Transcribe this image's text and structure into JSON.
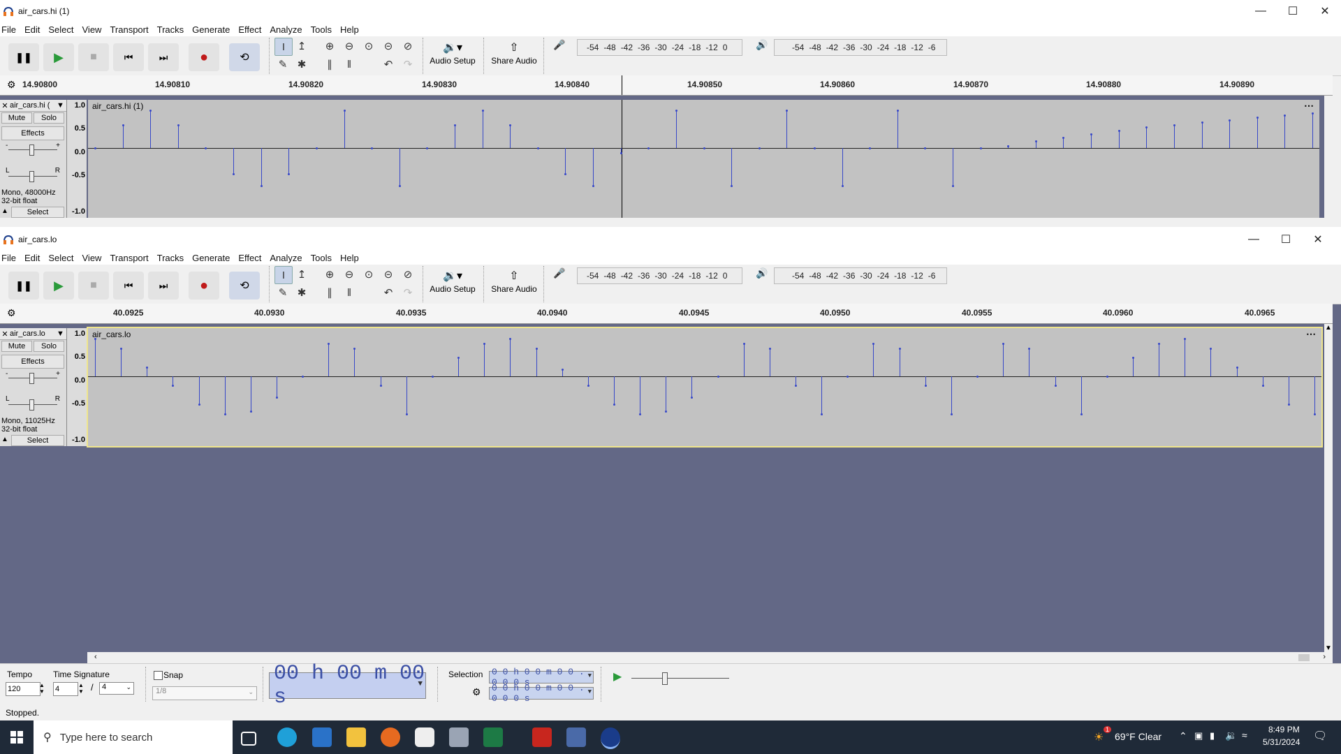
{
  "colors": {
    "accent": "#3647c8",
    "track_bg": "#636886",
    "wave_bg": "#c2c2c2",
    "time_text": "#3b4fa5"
  },
  "window1": {
    "title": "air_cars.hi (1)",
    "menu": [
      "File",
      "Edit",
      "Select",
      "View",
      "Transport",
      "Tracks",
      "Generate",
      "Effect",
      "Analyze",
      "Tools",
      "Help"
    ],
    "audio_setup": "Audio Setup",
    "share_audio": "Share Audio",
    "rec_meter": [
      "-54",
      "-48",
      "-42",
      "-36",
      "-30",
      "-24",
      "-18",
      "-12",
      "0"
    ],
    "play_meter": [
      "-54",
      "-48",
      "-42",
      "-36",
      "-30",
      "-24",
      "-18",
      "-12",
      "-6"
    ],
    "ruler": [
      "14.90800",
      "14.90810",
      "14.90820",
      "14.90830",
      "14.90840",
      "14.90850",
      "14.90860",
      "14.90870",
      "14.90880",
      "14.90890"
    ],
    "track": {
      "name": "air_cars.hi (",
      "clip": "air_cars.hi (1)",
      "mute": "Mute",
      "solo": "Solo",
      "effects": "Effects",
      "info1": "Mono, 48000Hz",
      "info2": "32-bit float",
      "select": "Select",
      "pan_l": "L",
      "pan_r": "R",
      "gain_minus": "-",
      "gain_plus": "+"
    },
    "scale": [
      "1.0",
      "0.5",
      "0.0",
      "-0.5",
      "-1.0"
    ],
    "samples": [
      0,
      0.5,
      0.8,
      0.5,
      0,
      -0.55,
      -0.8,
      -0.55,
      0,
      0.8,
      0,
      -0.8,
      0,
      0.5,
      0.8,
      0.5,
      0,
      -0.55,
      -0.8,
      -0.1,
      0,
      0.8,
      0,
      -0.8,
      0,
      0.8,
      0,
      -0.8,
      0,
      0.8,
      0,
      -0.8,
      0,
      0.05,
      0.15,
      0.22,
      0.3,
      0.38,
      0.45,
      0.5,
      0.55,
      0.6,
      0.65,
      0.7,
      0.75
    ]
  },
  "window2": {
    "title": "air_cars.lo",
    "menu": [
      "File",
      "Edit",
      "Select",
      "View",
      "Transport",
      "Tracks",
      "Generate",
      "Effect",
      "Analyze",
      "Tools",
      "Help"
    ],
    "audio_setup": "Audio Setup",
    "share_audio": "Share Audio",
    "rec_meter": [
      "-54",
      "-48",
      "-42",
      "-36",
      "-30",
      "-24",
      "-18",
      "-12",
      "0"
    ],
    "play_meter": [
      "-54",
      "-48",
      "-42",
      "-36",
      "-30",
      "-24",
      "-18",
      "-12",
      "-6"
    ],
    "ruler": [
      "40.0925",
      "40.0930",
      "40.0935",
      "40.0940",
      "40.0945",
      "40.0950",
      "40.0955",
      "40.0960",
      "40.0965"
    ],
    "track": {
      "name": "air_cars.lo",
      "clip": "air_cars.lo",
      "mute": "Mute",
      "solo": "Solo",
      "effects": "Effects",
      "info1": "Mono, 11025Hz",
      "info2": "32-bit float",
      "select": "Select",
      "pan_l": "L",
      "pan_r": "R",
      "gain_minus": "-",
      "gain_plus": "+"
    },
    "scale": [
      "1.0",
      "0.5",
      "0.0",
      "-0.5",
      "-1.0"
    ],
    "samples": [
      0.8,
      0.6,
      0.2,
      -0.2,
      -0.6,
      -0.8,
      -0.75,
      -0.45,
      0,
      0.7,
      0.6,
      -0.2,
      -0.8,
      0,
      0.4,
      0.7,
      0.8,
      0.6,
      0.15,
      -0.2,
      -0.6,
      -0.8,
      -0.75,
      -0.45,
      0,
      0.7,
      0.6,
      -0.2,
      -0.8,
      0,
      0.7,
      0.6,
      -0.2,
      -0.8,
      0,
      0.7,
      0.6,
      -0.2,
      -0.8,
      0,
      0.4,
      0.7,
      0.8,
      0.6,
      0.2,
      -0.2,
      -0.6,
      -0.8
    ]
  },
  "bottom": {
    "tempo_label": "Tempo",
    "tempo": "120",
    "timesig_label": "Time Signature",
    "ts_num": "4",
    "ts_slash": "/",
    "ts_den": "4",
    "snap_label": "Snap",
    "snap_value": "1/8",
    "time": "00 h 00 m 00 s",
    "selection_label": "Selection",
    "sel_start": "0 0 h 0 0 m 0 0 . 0 0 0 s",
    "sel_end": "0 0 h 0 0 m 0 0 . 0 0 0 s"
  },
  "status": "Stopped.",
  "taskbar": {
    "search": "Type here to search",
    "weather": "69°F  Clear",
    "time": "8:49 PM",
    "date": "5/31/2024",
    "badge": "1"
  }
}
